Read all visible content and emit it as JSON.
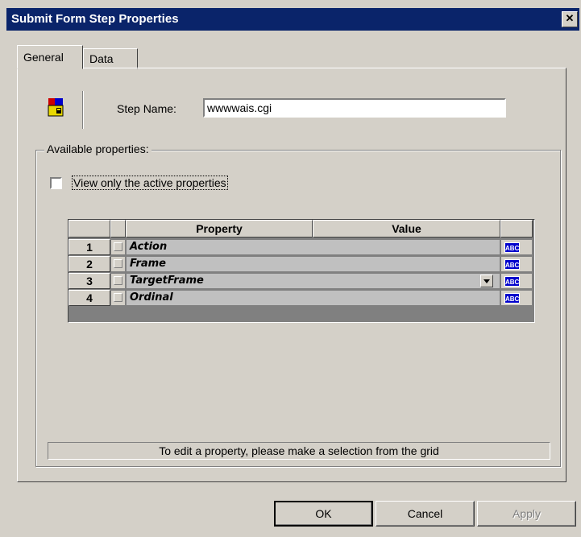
{
  "window": {
    "title": "Submit Form Step Properties",
    "close_glyph": "✕"
  },
  "tabs": [
    {
      "label": "General",
      "active": true
    },
    {
      "label": "Data",
      "active": false
    }
  ],
  "step": {
    "icon": "step-icon",
    "label": "Step Name:",
    "value": "wwwwais.cgi"
  },
  "properties_group": {
    "label": "Available properties:",
    "checkbox_label": "View only the active properties",
    "checked": false
  },
  "grid": {
    "columns": [
      "Property",
      "Value"
    ],
    "rows": [
      {
        "num": "1",
        "property": "Action",
        "value": "",
        "type_icon": "abc-icon",
        "type_text": "ABC",
        "has_dropdown": false
      },
      {
        "num": "2",
        "property": "Frame",
        "value": "",
        "type_icon": "abc-icon",
        "type_text": "ABC",
        "has_dropdown": false
      },
      {
        "num": "3",
        "property": "TargetFrame",
        "value": "",
        "type_icon": "abc-icon",
        "type_text": "ABC",
        "has_dropdown": true
      },
      {
        "num": "4",
        "property": "Ordinal",
        "value": "",
        "type_icon": "abc-icon",
        "type_text": "ABC",
        "has_dropdown": false
      }
    ]
  },
  "status": "To edit a property, please make a selection from the grid",
  "buttons": {
    "ok": "OK",
    "cancel": "Cancel",
    "apply": "Apply"
  },
  "colors": {
    "title_bar": "#0a246a",
    "face": "#d4d0c8",
    "abc_badge": "#0000cc"
  }
}
